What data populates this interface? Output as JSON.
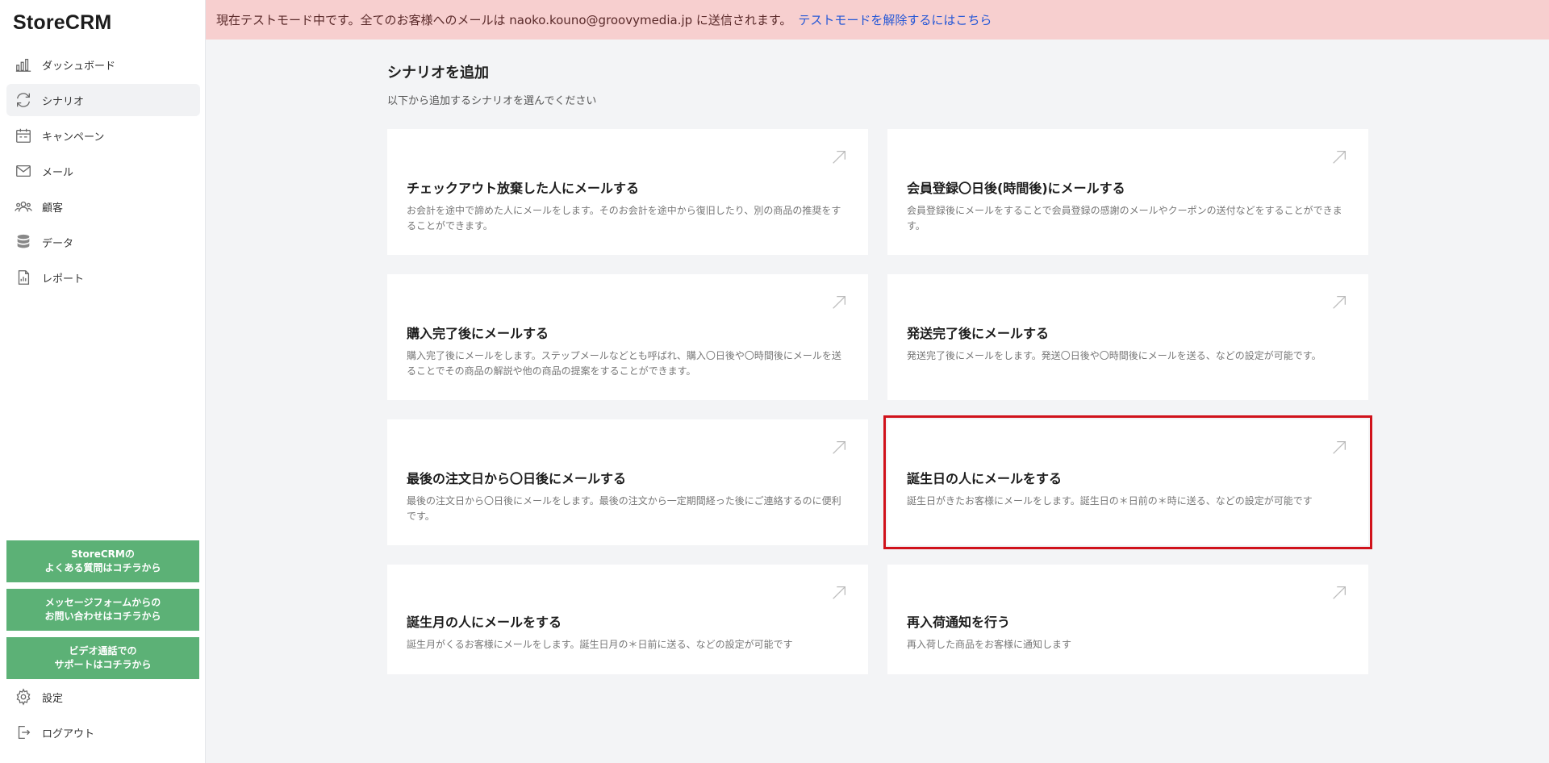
{
  "app": {
    "logo": "StoreCRM"
  },
  "sidebar": {
    "items": [
      {
        "label": "ダッシュボード",
        "icon": "bar-chart-icon"
      },
      {
        "label": "シナリオ",
        "icon": "refresh-icon",
        "active": true
      },
      {
        "label": "キャンペーン",
        "icon": "calendar-icon"
      },
      {
        "label": "メール",
        "icon": "mail-icon"
      },
      {
        "label": "顧客",
        "icon": "users-icon"
      },
      {
        "label": "データ",
        "icon": "database-icon"
      },
      {
        "label": "レポート",
        "icon": "report-icon"
      }
    ],
    "support": [
      {
        "line1": "StoreCRMの",
        "line2": "よくある質問はコチラから"
      },
      {
        "line1": "メッセージフォームからの",
        "line2": "お問い合わせはコチラから"
      },
      {
        "line1": "ビデオ通話での",
        "line2": "サポートはコチラから"
      }
    ],
    "bottom": [
      {
        "label": "設定",
        "icon": "gear-icon"
      },
      {
        "label": "ログアウト",
        "icon": "logout-icon"
      }
    ],
    "support_color": "#5cb176"
  },
  "banner": {
    "text": "現在テストモード中です。全てのお客様へのメールは naoko.kouno@groovymedia.jp に送信されます。",
    "link": "テストモードを解除するにはこちら",
    "bg": "#f7cfcf"
  },
  "page": {
    "title": "シナリオを追加",
    "subtitle": "以下から追加するシナリオを選んでください"
  },
  "cards": [
    {
      "title": "チェックアウト放棄した人にメールする",
      "desc": "お会計を途中で諦めた人にメールをします。そのお会計を途中から復旧したり、別の商品の推奨をすることができます。"
    },
    {
      "title": "会員登録〇日後(時間後)にメールする",
      "desc": "会員登録後にメールをすることで会員登録の感謝のメールやクーポンの送付などをすることができます。"
    },
    {
      "title": "購入完了後にメールする",
      "desc": "購入完了後にメールをします。ステップメールなどとも呼ばれ、購入〇日後や〇時間後にメールを送ることでその商品の解説や他の商品の提案をすることができます。"
    },
    {
      "title": "発送完了後にメールする",
      "desc": "発送完了後にメールをします。発送〇日後や〇時間後にメールを送る、などの設定が可能です。"
    },
    {
      "title": "最後の注文日から〇日後にメールする",
      "desc": "最後の注文日から〇日後にメールをします。最後の注文から一定期間経った後にご連絡するのに便利です。"
    },
    {
      "title": "誕生日の人にメールをする",
      "desc": "誕生日がきたお客様にメールをします。誕生日の＊日前の＊時に送る、などの設定が可能です",
      "selected": true
    },
    {
      "title": "誕生月の人にメールをする",
      "desc": "誕生月がくるお客様にメールをします。誕生日月の＊日前に送る、などの設定が可能です"
    },
    {
      "title": "再入荷通知を行う",
      "desc": "再入荷した商品をお客様に通知します"
    }
  ],
  "highlight_color": "#d0121b"
}
